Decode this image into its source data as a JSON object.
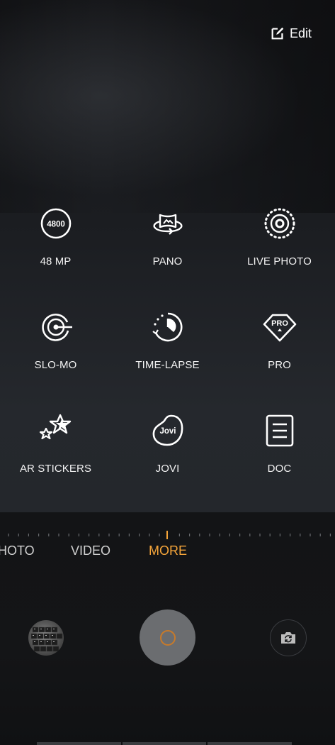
{
  "header": {
    "edit_label": "Edit",
    "edit_icon": "edit-icon"
  },
  "modes": [
    {
      "label": "48 MP",
      "icon": "48mp-icon",
      "badge": "4800"
    },
    {
      "label": "PANO",
      "icon": "pano-icon"
    },
    {
      "label": "LIVE PHOTO",
      "icon": "live-photo-icon"
    },
    {
      "label": "SLO-MO",
      "icon": "slo-mo-icon"
    },
    {
      "label": "TIME-LAPSE",
      "icon": "time-lapse-icon"
    },
    {
      "label": "PRO",
      "icon": "pro-icon",
      "badge": "PRO"
    },
    {
      "label": "AR STICKERS",
      "icon": "ar-stickers-icon"
    },
    {
      "label": "JOVI",
      "icon": "jovi-icon",
      "badge": "Jovi"
    },
    {
      "label": "DOC",
      "icon": "doc-icon"
    }
  ],
  "tabs": [
    {
      "label": "HOTO"
    },
    {
      "label": "VIDEO"
    },
    {
      "label": "MORE",
      "active": true
    }
  ],
  "controls": {
    "gallery_thumbnail": "gallery-thumbnail",
    "shutter": "shutter-button",
    "switch_camera": "switch-camera-icon"
  },
  "colors": {
    "accent": "#f5a53a",
    "shutter": "#6b6d70",
    "text": "#f2f2f2"
  }
}
